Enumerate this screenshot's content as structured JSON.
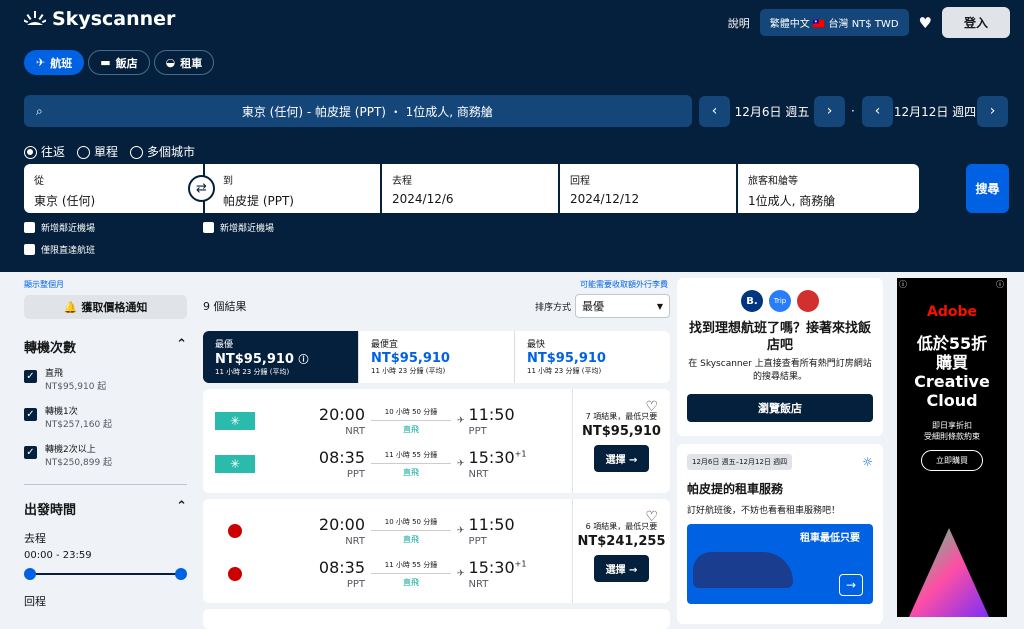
{
  "header": {
    "brand": "Skyscanner",
    "help": "說明",
    "locale": "繁體中文 🇹🇼 台灣 NT$ TWD",
    "login": "登入",
    "modes": [
      {
        "label": "航班",
        "icon": "plane-icon",
        "active": true
      },
      {
        "label": "飯店",
        "icon": "bed-icon",
        "active": false
      },
      {
        "label": "租車",
        "icon": "car-icon",
        "active": false
      }
    ],
    "summary": "東京 (任何) - 帕皮提 (PPT) ・ 1位成人, 商務艙",
    "depart_nav": "12月6日 週五",
    "return_nav": "12月12日 週四",
    "trip_types": [
      "往返",
      "單程",
      "多個城市"
    ],
    "form": {
      "from_label": "從",
      "from_value": "東京 (任何)",
      "to_label": "到",
      "to_value": "帕皮提 (PPT)",
      "depart_label": "去程",
      "depart_value": "2024/12/6",
      "return_label": "回程",
      "return_value": "2024/12/12",
      "pax_label": "旅客和艙等",
      "pax_value": "1位成人, 商務艙"
    },
    "search": "搜尋",
    "nearby1": "新增鄰近機場",
    "nearby2": "新增鄰近機場",
    "direct": "僅限直達航班"
  },
  "links": {
    "month": "顯示整個月",
    "fees": "可能需要收取額外行李費"
  },
  "left": {
    "alert": "獲取價格通知",
    "stops_title": "轉機次數",
    "stops": [
      {
        "label": "直飛",
        "price": "NT$95,910 起"
      },
      {
        "label": "轉機1次",
        "price": "NT$257,160 起"
      },
      {
        "label": "轉機2次以上",
        "price": "NT$250,899 起"
      }
    ],
    "time_title": "出發時間",
    "outbound": "去程",
    "outbound_range": "00:00 - 23:59",
    "inbound": "回程"
  },
  "results": {
    "count": "9 個結果",
    "sort_label": "排序方式",
    "sort_value": "最優",
    "tabs": [
      {
        "name": "最優",
        "price": "NT$95,910",
        "dur": "11 小時 23 分鐘 (平均)"
      },
      {
        "name": "最便宜",
        "price": "NT$95,910",
        "dur": "11 小時 23 分鐘 (平均)"
      },
      {
        "name": "最快",
        "price": "NT$95,910",
        "dur": "11 小時 23 分鐘 (平均)"
      }
    ],
    "cards": [
      {
        "legs": [
          {
            "dep": "20:00",
            "from": "NRT",
            "dur": "10 小時 50 分鐘",
            "type": "直飛",
            "arr": "11:50",
            "sup": "",
            "to": "PPT"
          },
          {
            "dep": "08:35",
            "from": "PPT",
            "dur": "11 小時 55 分鐘",
            "type": "直飛",
            "arr": "15:30",
            "sup": "+1",
            "to": "NRT"
          }
        ],
        "note": "7 項結果，最低只要",
        "price": "NT$95,910",
        "select": "選擇 →"
      },
      {
        "legs": [
          {
            "dep": "20:00",
            "from": "NRT",
            "dur": "10 小時 50 分鐘",
            "type": "直飛",
            "arr": "11:50",
            "sup": "",
            "to": "PPT"
          },
          {
            "dep": "08:35",
            "from": "PPT",
            "dur": "11 小時 55 分鐘",
            "type": "直飛",
            "arr": "15:30",
            "sup": "+1",
            "to": "NRT"
          }
        ],
        "note": "6 項結果，最低只要",
        "price": "NT$241,255",
        "select": "選擇 →"
      }
    ]
  },
  "right": {
    "hotel_title": "找到理想航班了嗎？接著來找飯店吧",
    "hotel_text": "在 Skyscanner 上直接查看所有熱門訂房網站的搜尋結果。",
    "hotel_btn": "瀏覽飯店",
    "car_dates": "12月6日 週五–12月12日 週四",
    "car_title": "帕皮提的租車服務",
    "car_text": "訂好航班後，不妨也看看租車服務吧！",
    "car_promo": "租車最低只要"
  },
  "ad": {
    "brand": "Adobe",
    "line1": "低於55折",
    "line2": "購買",
    "line3": "Creative",
    "line4": "Cloud",
    "line5": "即日享折扣",
    "line6": "受細則條款約束",
    "cta": "立即購買"
  }
}
